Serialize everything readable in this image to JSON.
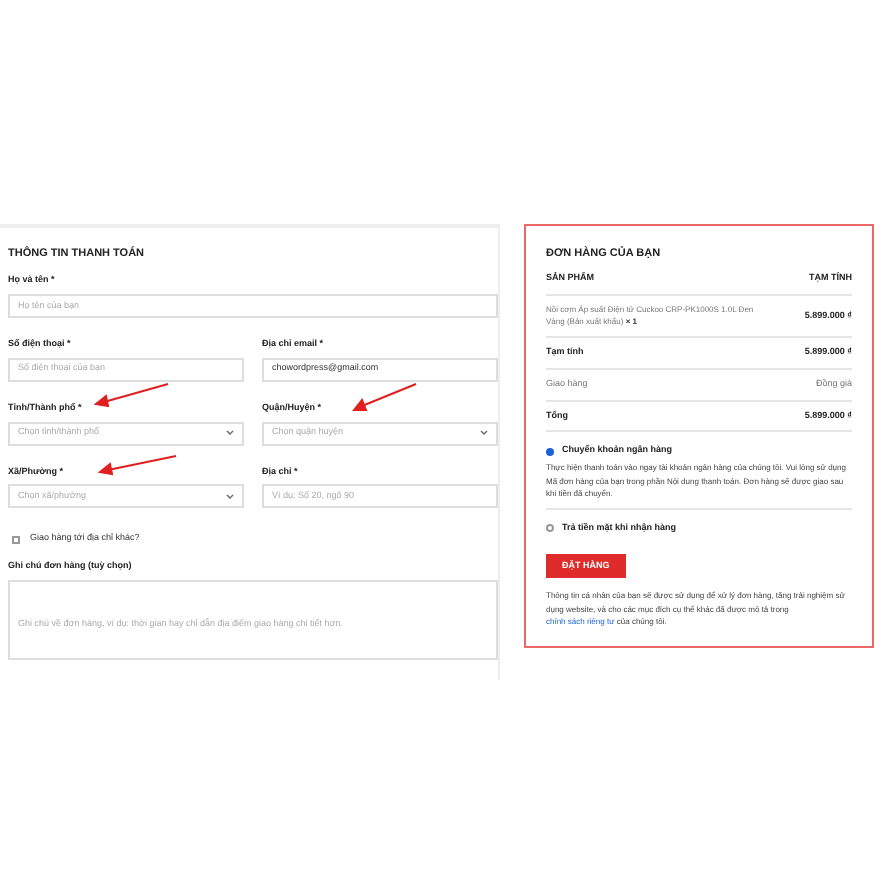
{
  "billing": {
    "title": "THÔNG TIN THANH TOÁN",
    "fields": [
      {
        "kind": "input",
        "label": "Họ và tên *",
        "placeholder": "Họ tên của bạn",
        "wide": true
      },
      {
        "kind": "input",
        "label": "Số điện thoại *",
        "placeholder": "Số điện thoại của bạn"
      },
      {
        "kind": "input",
        "label": "Địa chỉ email *",
        "value": "chowordpress@gmail.com"
      },
      {
        "kind": "select",
        "label": "Tỉnh/Thành phố *",
        "placeholder": "Chọn tỉnh/thành phố"
      },
      {
        "kind": "select",
        "label": "Quận/Huyện *",
        "placeholder": "Chọn quận huyện"
      },
      {
        "kind": "select",
        "label": "Xã/Phường *",
        "placeholder": "Chọn xã/phường"
      },
      {
        "kind": "input",
        "label": "Địa chỉ *",
        "placeholder": "Ví dụ: Số 20, ngõ 90"
      }
    ],
    "ship_elsewhere": {
      "label": "Giao hàng tới địa chỉ khác?",
      "checked": false
    },
    "notes": {
      "label": "Ghi chú đơn hàng (tuỳ chọn)",
      "placeholder": "Ghi chú về đơn hàng, ví dụ: thời gian hay chỉ dẫn địa điểm giao hàng chi tiết hơn."
    }
  },
  "order": {
    "title": "ĐƠN HÀNG CỦA BẠN",
    "columns": [
      "SẢN PHẨM",
      "TẠM TÍNH"
    ],
    "items": [
      {
        "name": "Nồi cơm Áp suất Điện tử Cuckoo CRP-PK1000S 1.0L Đen Vàng (Bản xuất khẩu)",
        "qty": "× 1",
        "price": "5.899.000 ₫"
      }
    ],
    "rows": [
      {
        "kind": "bold",
        "label": "Tạm tính",
        "value": "5.899.000 ₫"
      },
      {
        "kind": "light",
        "label": "Giao hàng",
        "value": "Đồng giá"
      },
      {
        "kind": "bold",
        "label": "Tổng",
        "value": "5.899.000 ₫"
      }
    ],
    "payment_methods": [
      {
        "label": "Chuyển khoản ngân hàng",
        "selected": true,
        "description": "Thực hiện thanh toán vào ngay tài khoản ngân hàng của chúng tôi. Vui lòng sử dụng Mã đơn hàng của bạn trong phần Nội dung thanh toán. Đơn hàng sẽ được giao sau khi tiền đã chuyển."
      },
      {
        "label": "Trả tiền mặt khi nhận hàng",
        "selected": false
      }
    ],
    "button": "ĐẶT HÀNG",
    "privacy": {
      "before": "Thông tin cá nhân của bạn sẽ được sử dụng để xử lý đơn hàng, tăng trải nghiệm sử dụng website, và cho các mục đích cụ thể khác đã được mô tả trong",
      "link": "chính sách riêng tư",
      "after": "của chúng tôi."
    }
  }
}
